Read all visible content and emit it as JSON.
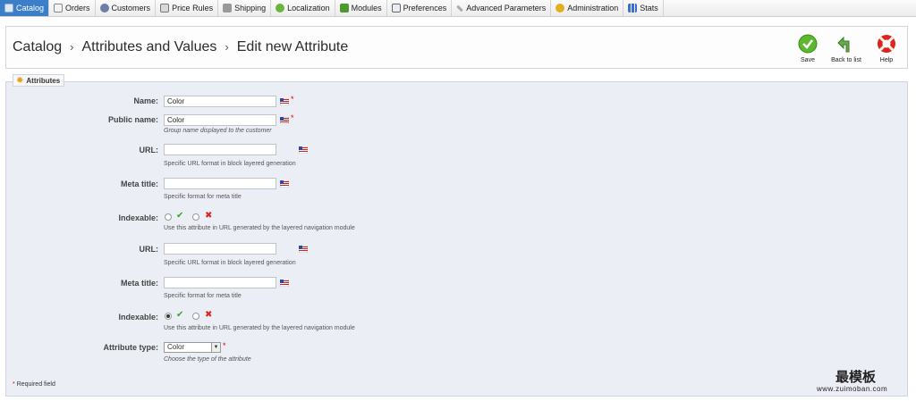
{
  "nav": {
    "tabs": [
      {
        "label": "Catalog",
        "icon": "catalog-icon",
        "active": true
      },
      {
        "label": "Orders",
        "icon": "orders-icon"
      },
      {
        "label": "Customers",
        "icon": "customers-icon"
      },
      {
        "label": "Price Rules",
        "icon": "price-rules-icon"
      },
      {
        "label": "Shipping",
        "icon": "shipping-icon"
      },
      {
        "label": "Localization",
        "icon": "localization-icon"
      },
      {
        "label": "Modules",
        "icon": "modules-icon"
      },
      {
        "label": "Preferences",
        "icon": "preferences-icon"
      },
      {
        "label": "Advanced Parameters",
        "icon": "advanced-parameters-icon"
      },
      {
        "label": "Administration",
        "icon": "administration-icon"
      },
      {
        "label": "Stats",
        "icon": "stats-icon"
      }
    ]
  },
  "breadcrumb": {
    "item1": "Catalog",
    "item2": "Attributes and Values",
    "item3": "Edit new Attribute",
    "sep": "›"
  },
  "toolbar": {
    "save_label": "Save",
    "back_label": "Back to list",
    "help_label": "Help"
  },
  "form": {
    "legend": "Attributes",
    "name_label": "Name:",
    "name_value": "Color",
    "public_name_label": "Public name:",
    "public_name_value": "Color",
    "public_name_hint": "Group name displayed to the customer",
    "url1_label": "URL:",
    "url1_value": "",
    "url1_hint": "Specific URL format in block layered generation",
    "meta1_label": "Meta title:",
    "meta1_value": "",
    "meta1_hint": "Specific format for meta title",
    "indexable1_label": "Indexable:",
    "indexable1_selected": "no",
    "indexable1_hint": "Use this attribute in URL generated by the layered navigation module",
    "url2_label": "URL:",
    "url2_value": "",
    "url2_hint": "Specific URL format in block layered generation",
    "meta2_label": "Meta title:",
    "meta2_value": "",
    "meta2_hint": "Specific format for meta title",
    "indexable2_label": "Indexable:",
    "indexable2_selected": "yes",
    "indexable2_hint": "Use this attribute in URL generated by the layered navigation module",
    "type_label": "Attribute type:",
    "type_value": "Color",
    "type_hint": "Choose the type of the attribute",
    "required_star": "*",
    "required_note": "Required field",
    "check_glyph": "✔",
    "cross_glyph": "✖",
    "dropdown_glyph": "▼"
  },
  "watermark": {
    "cn": "最模板",
    "url": "www.zuimoban.com"
  },
  "colors": {
    "active_tab": "#3b7fc9",
    "panel_bg": "#eceef6",
    "required": "#d00000",
    "save_green": "#4caf28",
    "help_red": "#e2231a"
  }
}
